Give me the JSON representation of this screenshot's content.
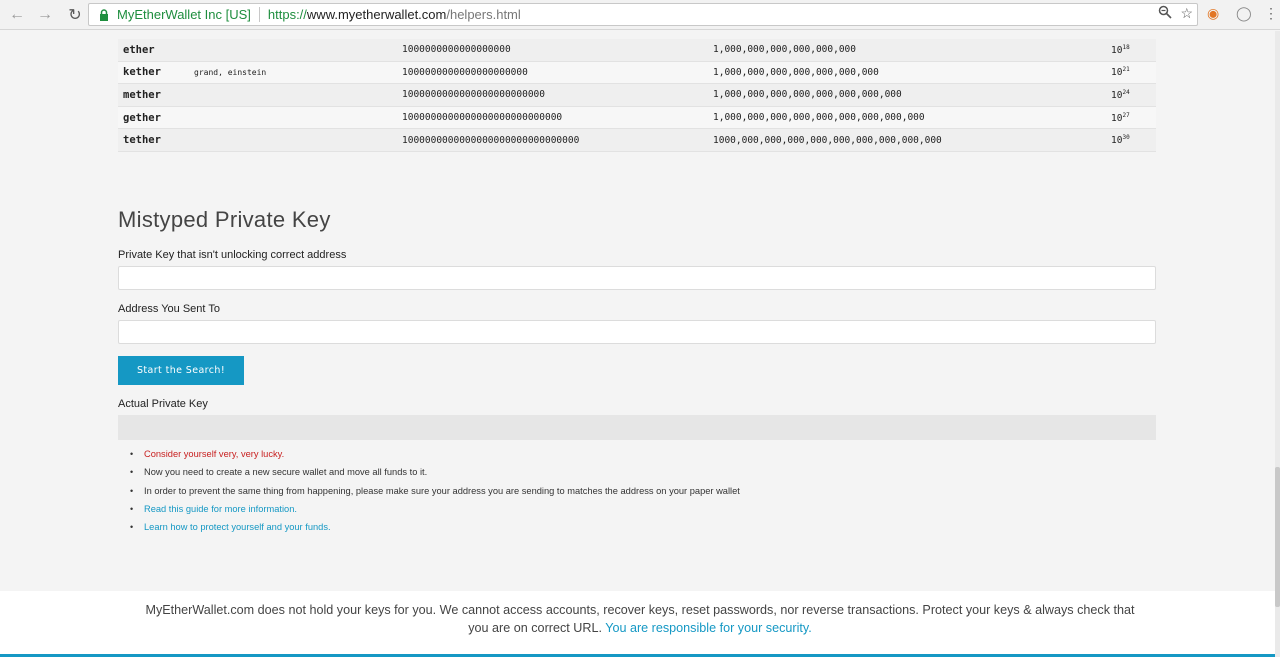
{
  "browser": {
    "ev_label": "MyEtherWallet Inc [US]",
    "url_scheme": "https://",
    "url_host": "www.myetherwallet.com",
    "url_path": "/helpers.html"
  },
  "units": [
    {
      "name": "ether",
      "alt": "",
      "wei": "1000000000000000000",
      "formatted": "1,000,000,000,000,000,000",
      "pow_base": "10",
      "pow_exp": "18"
    },
    {
      "name": "kether",
      "alt": "grand, einstein",
      "wei": "1000000000000000000000",
      "formatted": "1,000,000,000,000,000,000,000",
      "pow_base": "10",
      "pow_exp": "21"
    },
    {
      "name": "mether",
      "alt": "",
      "wei": "1000000000000000000000000",
      "formatted": "1,000,000,000,000,000,000,000,000",
      "pow_base": "10",
      "pow_exp": "24"
    },
    {
      "name": "gether",
      "alt": "",
      "wei": "1000000000000000000000000000",
      "formatted": "1,000,000,000,000,000,000,000,000,000",
      "pow_base": "10",
      "pow_exp": "27"
    },
    {
      "name": "tether",
      "alt": "",
      "wei": "1000000000000000000000000000000",
      "formatted": "1000,000,000,000,000,000,000,000,000,000",
      "pow_base": "10",
      "pow_exp": "30"
    }
  ],
  "mistyped": {
    "title": "Mistyped Private Key",
    "private_key_label": "Private Key that isn't unlocking correct address",
    "private_key_value": "",
    "address_label": "Address You Sent To",
    "address_value": "",
    "search_button": "Start the Search!",
    "actual_key_label": "Actual Private Key",
    "notes": [
      {
        "text": "Consider yourself very, very lucky.",
        "style": "red"
      },
      {
        "text": "Now you need to create a new secure wallet and move all funds to it.",
        "style": "plain"
      },
      {
        "text": "In order to prevent the same thing from happening, please make sure your address you are sending to matches the address on your paper wallet",
        "style": "plain"
      },
      {
        "text": "Read this guide for more information.",
        "style": "link"
      },
      {
        "text": "Learn how to protect yourself and your funds.",
        "style": "link"
      }
    ]
  },
  "footer": {
    "line1": "MyEtherWallet.com does not hold your keys for you. We cannot access accounts, recover keys, reset passwords, nor reverse transactions. Protect your keys & always check that",
    "line2_prefix": "you are on correct URL. ",
    "line2_link": "You are responsible for your security."
  },
  "colors": {
    "accent": "#1598c4",
    "warning": "#c81f1f",
    "secure_green": "#1e8e3e"
  }
}
